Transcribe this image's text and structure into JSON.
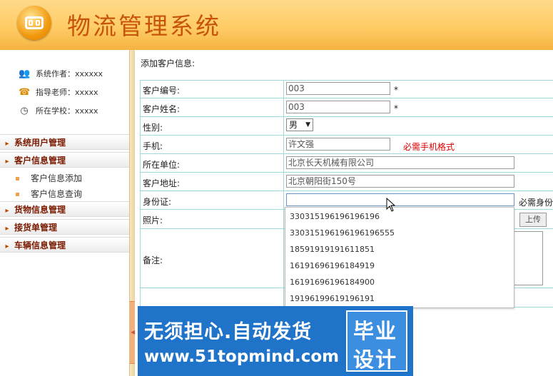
{
  "header": {
    "title": "物流管理系统"
  },
  "sidebar": {
    "info": [
      {
        "icon": "users-icon",
        "label": "系统作者：xxxxxx"
      },
      {
        "icon": "teacher-icon",
        "label": "指导老师：xxxxx"
      },
      {
        "icon": "clock-icon",
        "label": "所在学校：xxxxx"
      }
    ],
    "menus": [
      {
        "label": "系统用户管理"
      },
      {
        "label": "客户信息管理",
        "children": [
          "客户信息添加",
          "客户信息查询"
        ]
      },
      {
        "label": "货物信息管理"
      },
      {
        "label": "接货单管理"
      },
      {
        "label": "车辆信息管理"
      }
    ]
  },
  "form": {
    "caption": "添加客户信息:",
    "fields": {
      "code": {
        "label": "客户编号:",
        "value": "003",
        "required": "*"
      },
      "name": {
        "label": "客户姓名:",
        "value": "003",
        "required": "*"
      },
      "gender": {
        "label": "性别:",
        "value": "男"
      },
      "phone": {
        "label": "手机:",
        "value": "许文强",
        "hint": "必需手机格式"
      },
      "company": {
        "label": "所在单位:",
        "value": "北京长天机械有限公司"
      },
      "address": {
        "label": "客户地址:",
        "value": "北京朝阳街150号"
      },
      "idcard": {
        "label": "身份证:",
        "value": "",
        "hint": "必需身份"
      },
      "photo": {
        "label": "照片:",
        "upload_label": "上传"
      },
      "remark": {
        "label": "备注:"
      }
    },
    "autocomplete": [
      "330315196196196196",
      "330315196196196196555",
      "18591919191611851",
      "16191696196184919",
      "16191696196184900",
      "19196199619196191"
    ]
  },
  "watermark": {
    "line1": "无须担心.自动发货",
    "line2": "www.51topmind.com",
    "badge1": "毕业",
    "badge2": "设计"
  }
}
